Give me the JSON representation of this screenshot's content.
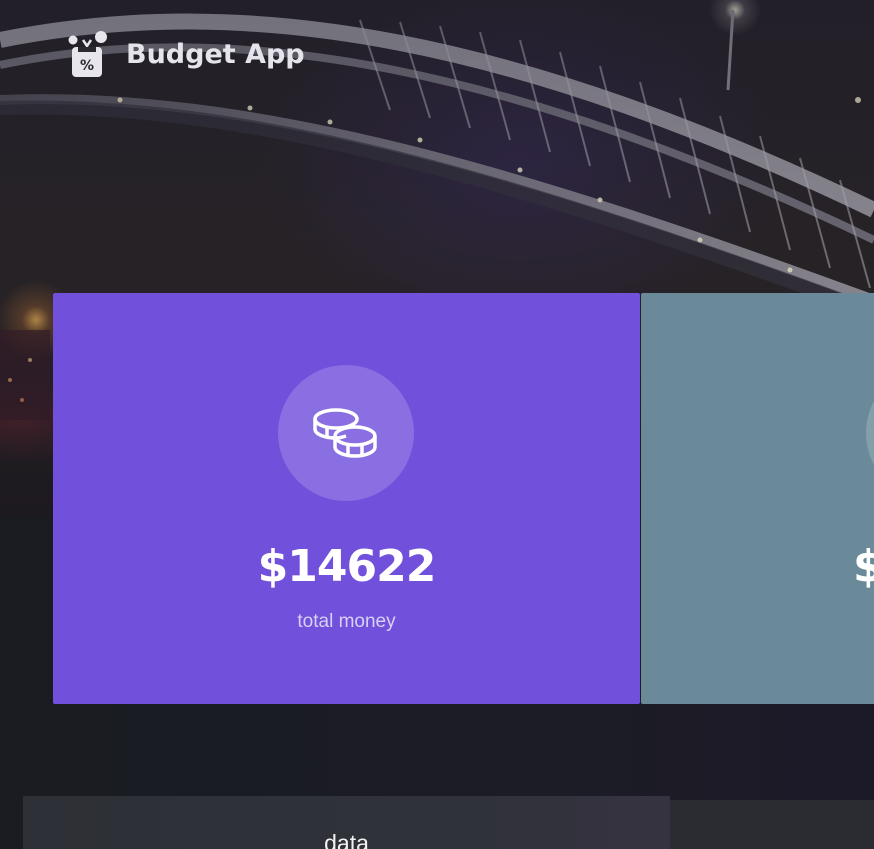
{
  "app": {
    "title": "Budget App",
    "logo_icon": "budget-app-logo-icon"
  },
  "cards": [
    {
      "id": "total",
      "amount": "$14622",
      "caption": "total money",
      "icon": "coins-icon",
      "color": "#7150dc"
    },
    {
      "id": "second",
      "amount": "$",
      "icon": "circle-icon",
      "color": "#6a8a9a"
    }
  ],
  "panels": {
    "data_title": "data"
  }
}
